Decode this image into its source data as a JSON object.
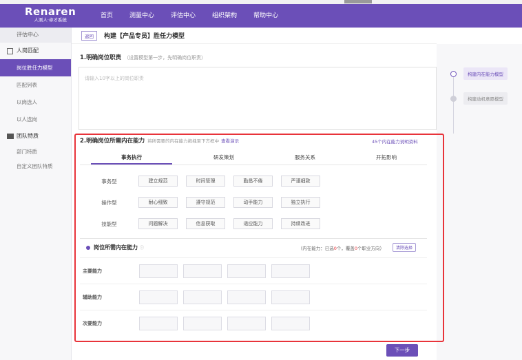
{
  "brand": {
    "name": "Renaren",
    "subtitle": "人测人·卓才系统"
  },
  "nav": [
    "首页",
    "测量中心",
    "评估中心",
    "组织架构",
    "帮助中心"
  ],
  "sidebar": {
    "title": "评估中心",
    "group1": {
      "label": "人岗匹配",
      "items": [
        "岗位胜任力模型",
        "匹配列表",
        "以岗选人",
        "以人选岗"
      ]
    },
    "group2": {
      "label": "团队特质",
      "items": [
        "部门特质",
        "自定义团队特质"
      ]
    }
  },
  "crumb": {
    "back": "返回",
    "title": "构建【产品专员】胜任力模型"
  },
  "section1": {
    "title": "1.明确岗位职责",
    "hint": "（设置模型第一步，先明确岗位职责）",
    "placeholder": "请输入10字以上的岗位职责"
  },
  "steps": [
    {
      "label": "构建内在能力模型"
    },
    {
      "label": "构建动机意愿模型"
    }
  ],
  "section2": {
    "title": "2.明确岗位所需内在能力",
    "hint": "将所需要的内在能力拖拽至下方框中",
    "demo": "查看演示",
    "link": "45个内在能力说明资料",
    "tabs": [
      "事务执行",
      "研发策划",
      "服务关系",
      "开拓影响"
    ],
    "rows": [
      {
        "label": "事务型",
        "chips": [
          "建立规范",
          "时间管理",
          "勤恳不倦",
          "严谨细致"
        ]
      },
      {
        "label": "操作型",
        "chips": [
          "耐心细致",
          "遵守规范",
          "动手能力",
          "独立执行"
        ]
      },
      {
        "label": "技能型",
        "chips": [
          "问题解决",
          "信息获取",
          "适应能力",
          "持续改进"
        ]
      }
    ]
  },
  "section3": {
    "title": "岗位所需内在能力",
    "info_icon": "info-icon",
    "summary_prefix": "（内在能力：已选",
    "selected": "0",
    "summary_mid": "个，覆盖",
    "covered": "0",
    "summary_suffix": "个职业方向）",
    "clear": "清除选择",
    "rows": [
      "主要能力",
      "辅助能力",
      "次要能力"
    ]
  },
  "next": "下一步",
  "colors": {
    "accent": "#6b4fb8",
    "highlight": "#e8333a"
  }
}
